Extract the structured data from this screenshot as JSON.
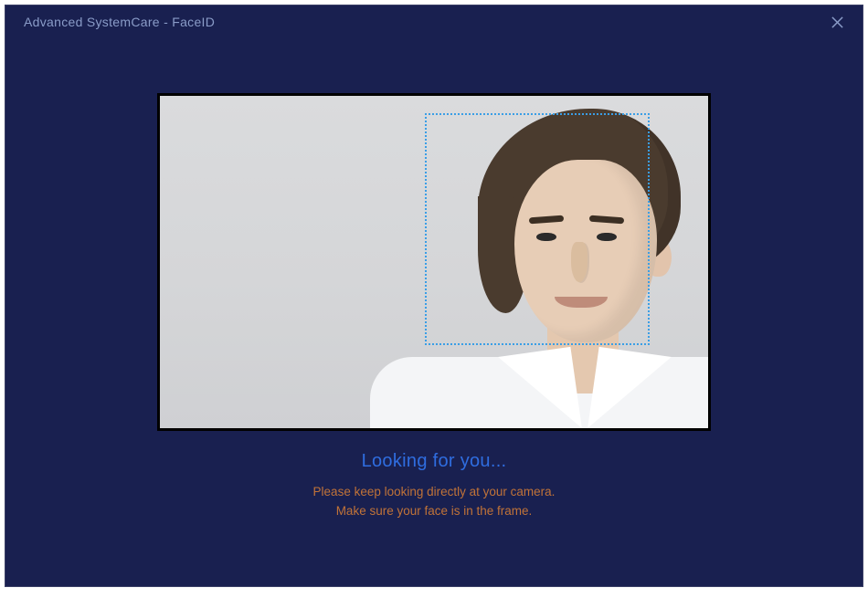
{
  "window": {
    "title": "Advanced SystemCare - FaceID"
  },
  "camera": {
    "face_box_alt": "face-detection-box"
  },
  "status": {
    "headline": "Looking for you...",
    "hint_line1": "Please keep looking directly at your camera.",
    "hint_line2": "Make sure your face is in the frame."
  },
  "colors": {
    "window_bg": "#192050",
    "accent_blue": "#2f6de0",
    "hint_orange": "#c17338",
    "detection_box": "#3a9ee6"
  }
}
